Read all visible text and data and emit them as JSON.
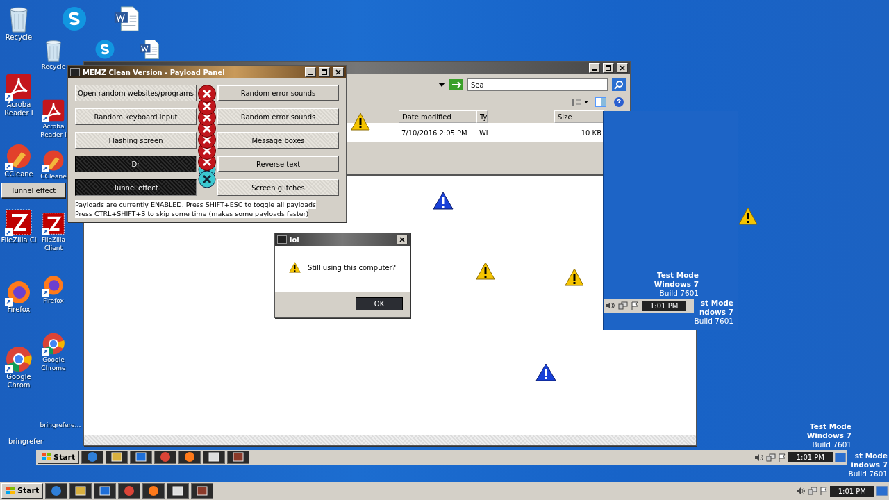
{
  "desktop_icon_columns": [
    [
      {
        "kind": "recycle",
        "label": "Recycle"
      },
      {
        "kind": "acrobat",
        "label": "Acroba Reader I"
      },
      {
        "kind": "ccleaner",
        "label": "CCleane"
      },
      {
        "kind": "filezilla",
        "label": "FileZilla Cl"
      },
      {
        "kind": "firefox",
        "label": "Firefox"
      },
      {
        "kind": "chrome",
        "label": "Google Chrom"
      },
      {
        "kind": "none",
        "label": "bringrefer"
      }
    ],
    [
      {
        "kind": "recycle",
        "label": "Recycle"
      },
      {
        "kind": "acrobat",
        "label": "Acroba Reader I"
      },
      {
        "kind": "ccleaner",
        "label": "CCleane"
      },
      {
        "kind": "filezilla",
        "label": "FileZilla Client"
      },
      {
        "kind": "firefox",
        "label": "Firefox"
      },
      {
        "kind": "chrome",
        "label": "Google Chrome"
      },
      {
        "kind": "none",
        "label": "bringrefere…"
      }
    ]
  ],
  "top_icons": [
    {
      "kind": "skype"
    },
    {
      "kind": "word"
    },
    {
      "kind": "skype"
    },
    {
      "kind": "word"
    }
  ],
  "explorer": {
    "search": {
      "value": "Sea"
    },
    "columns": [
      "Date modified",
      "Ty",
      "Size"
    ],
    "row": [
      "7/10/2016 2:05 PM",
      "Wi",
      "10 KB"
    ]
  },
  "payload_panel": {
    "title": "MEMZ Clean Version - Payload Panel",
    "buttons": [
      {
        "label": "Open random websites/programs",
        "active": false,
        "raised": false
      },
      {
        "label": "Random error sounds",
        "active": false,
        "raised": true
      },
      {
        "label": "Random keyboard input",
        "active": false,
        "raised": false
      },
      {
        "label": "Random error sounds",
        "active": false,
        "raised": false
      },
      {
        "label": "Flashing screen",
        "active": false,
        "raised": false
      },
      {
        "label": "Message boxes",
        "active": false,
        "raised": false
      },
      {
        "label": "Dr",
        "active": true,
        "raised": false
      },
      {
        "label": "Reverse text",
        "active": false,
        "raised": true
      },
      {
        "label": "Tunnel effect",
        "active": true,
        "raised": false
      },
      {
        "label": "Screen glitches",
        "active": false,
        "raised": false
      }
    ],
    "floating_button": "Tunnel effect",
    "status": [
      "Payloads are currently ENABLED. Press SHIFT+ESC to toggle all payloads",
      "Press CTRL+SHIFT+S to skip some time (makes some payloads faster)"
    ]
  },
  "message_box": {
    "title": "lol",
    "message": "Still using this computer?",
    "button": "OK"
  },
  "warning_icons": [
    {
      "kind": "warning"
    },
    {
      "kind": "info"
    },
    {
      "kind": "warning"
    },
    {
      "kind": "warning"
    },
    {
      "kind": "info"
    },
    {
      "kind": "warning"
    }
  ],
  "test_mode": [
    [
      "Test Mode",
      "Windows 7",
      "Build 7601"
    ],
    [
      "st Mode",
      "ndows 7",
      "Build 7601"
    ],
    [
      "Test Mode",
      "Windows 7",
      "Build 7601"
    ],
    [
      "st Mode",
      "indows 7",
      "Build 7601"
    ]
  ],
  "taskbars": [
    {
      "start": "Start",
      "apps": [
        {
          "kind": "ie"
        },
        {
          "kind": "explorer"
        },
        {
          "kind": "media"
        },
        {
          "kind": "chrome"
        },
        {
          "kind": "firefox"
        },
        {
          "kind": "calc"
        },
        {
          "kind": "memz"
        }
      ],
      "time": "1:01 PM"
    },
    {
      "start": "Start",
      "apps": [
        {
          "kind": "ie"
        },
        {
          "kind": "explorer"
        },
        {
          "kind": "media"
        },
        {
          "kind": "chrome"
        },
        {
          "kind": "firefox"
        },
        {
          "kind": "calc"
        },
        {
          "kind": "memz"
        }
      ],
      "time": "1:01 PM"
    }
  ],
  "glitch_tray": {
    "time": "1:01 PM"
  }
}
